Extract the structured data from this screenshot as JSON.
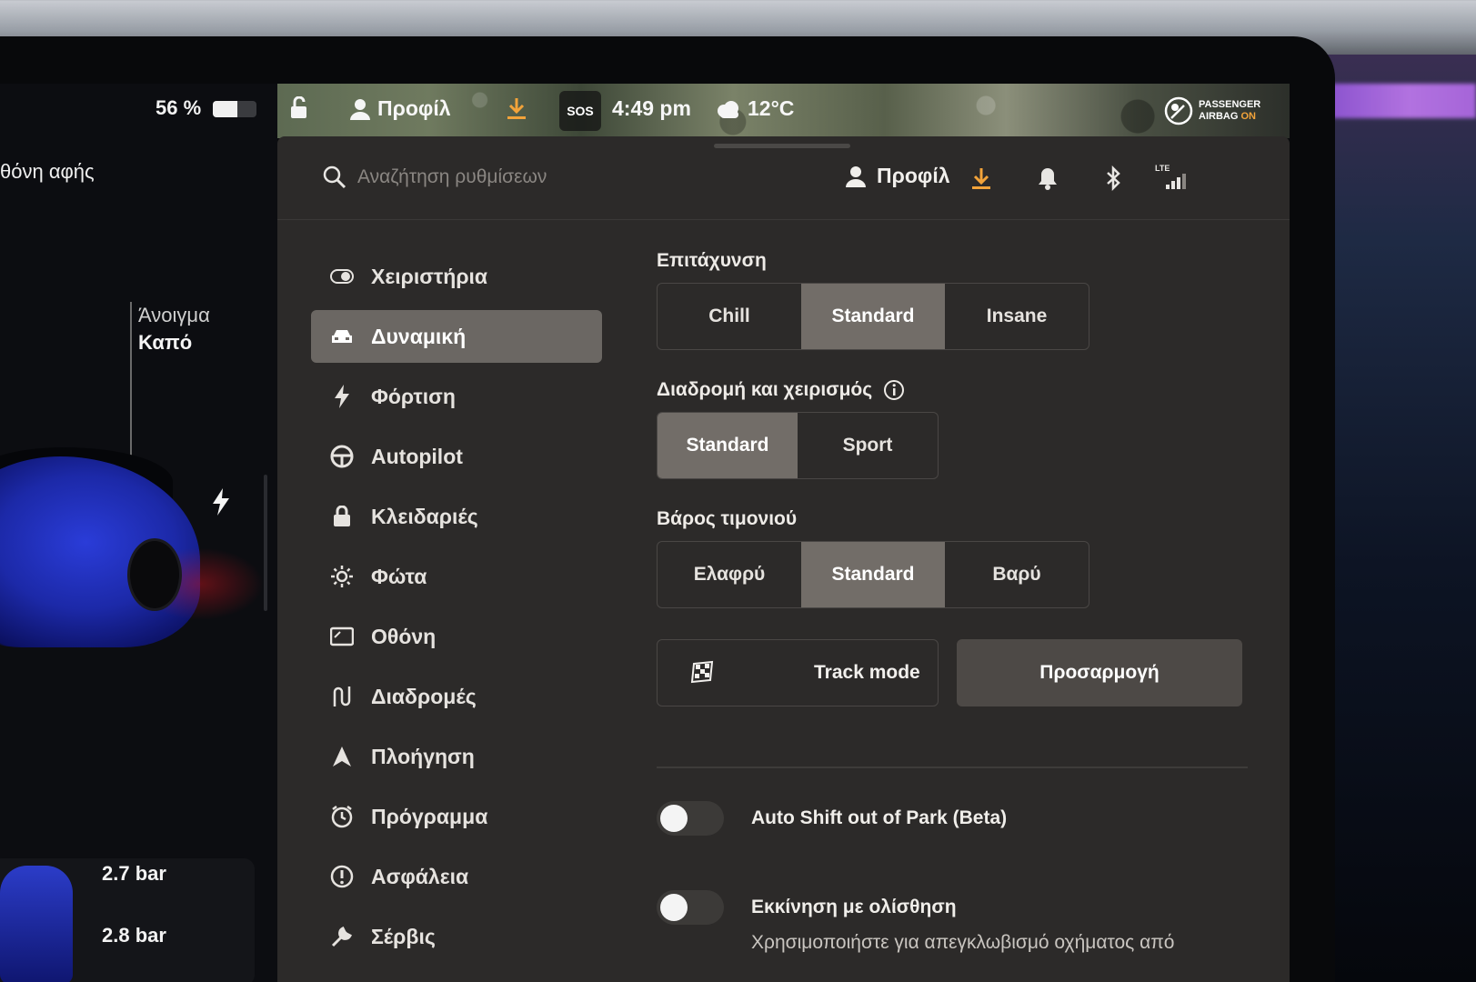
{
  "left_pane": {
    "battery_percent": "56 %",
    "battery_level": 0.56,
    "touch_label": "θόνη αφής",
    "open_label": "Άνοιγμα",
    "open_value": "Καπό",
    "tire_front": "2.7 bar",
    "tire_rear": "2.8 bar"
  },
  "status_bar": {
    "profile_label": "Προφίλ",
    "sos_label": "SOS",
    "time": "4:49 pm",
    "temperature": "12°C",
    "airbag_line1": "PASSENGER",
    "airbag_line2_prefix": "AIRBAG",
    "airbag_line2_state": "ON"
  },
  "top_bar": {
    "search_placeholder": "Αναζήτηση ρυθμίσεων",
    "profile_label": "Προφίλ",
    "signal_label": "LTE"
  },
  "colors": {
    "accent_download": "#f2a33a",
    "panel_bg": "#2c2a29",
    "selected_bg": "#726d68"
  },
  "nav": {
    "items": [
      {
        "label": "Χειριστήρια",
        "icon": "toggle-icon"
      },
      {
        "label": "Δυναμική",
        "icon": "car-icon",
        "active": true
      },
      {
        "label": "Φόρτιση",
        "icon": "bolt-icon"
      },
      {
        "label": "Autopilot",
        "icon": "steering-wheel-icon"
      },
      {
        "label": "Κλειδαριές",
        "icon": "lock-icon"
      },
      {
        "label": "Φώτα",
        "icon": "light-icon"
      },
      {
        "label": "Οθόνη",
        "icon": "display-icon"
      },
      {
        "label": "Διαδρομές",
        "icon": "trips-icon"
      },
      {
        "label": "Πλοήγηση",
        "icon": "navigation-icon"
      },
      {
        "label": "Πρόγραμμα",
        "icon": "schedule-icon"
      },
      {
        "label": "Ασφάλεια",
        "icon": "safety-icon"
      },
      {
        "label": "Σέρβις",
        "icon": "wrench-icon"
      }
    ]
  },
  "content": {
    "acceleration": {
      "label": "Επιτάχυνση",
      "options": [
        "Chill",
        "Standard",
        "Insane"
      ],
      "selected": "Standard"
    },
    "ride_handling": {
      "label": "Διαδρομή και χειρισμός",
      "options": [
        "Standard",
        "Sport"
      ],
      "selected": "Standard"
    },
    "steering": {
      "label": "Βάρος τιμονιού",
      "options": [
        "Ελαφρύ",
        "Standard",
        "Βαρύ"
      ],
      "selected": "Standard"
    },
    "track_mode_label": "Track mode",
    "customize_label": "Προσαρμογή",
    "toggles": [
      {
        "label": "Auto Shift out of Park (Beta)",
        "on": false
      },
      {
        "label": "Εκκίνηση με ολίσθηση",
        "on": false,
        "description": "Χρησιμοποιήστε για απεγκλωβισμό οχήματος από"
      }
    ]
  }
}
